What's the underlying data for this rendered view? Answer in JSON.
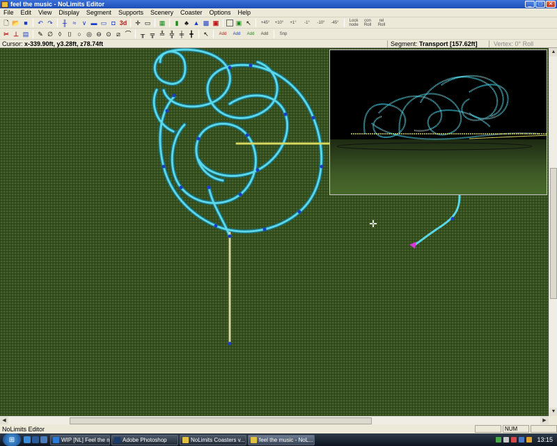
{
  "window": {
    "title": "feel the music - NoLimits Editor",
    "buttons": {
      "minimize": "_",
      "maximize": "□",
      "close": "✕"
    }
  },
  "menu": [
    "File",
    "Edit",
    "View",
    "Display",
    "Segment",
    "Supports",
    "Scenery",
    "Coaster",
    "Options",
    "Help"
  ],
  "toolbar1": {
    "label_3d": "3d",
    "angle_buttons": [
      "+45°",
      "+10°",
      "+1°",
      "-1°",
      "-10°",
      "-45°"
    ],
    "lock_label": "Lock node",
    "con_roll_label": "con Roll",
    "rel_roll_label": "rel Roll"
  },
  "toolbar2": {
    "add_labels": [
      "Add",
      "Add",
      "Add",
      "Add"
    ],
    "snp_label": "Snp"
  },
  "info": {
    "cursor_label": "Cursor:",
    "cursor_value": "x-339.90ft, y3.28ft, z78.74ft",
    "segment_label": "Segment:",
    "segment_value": "Transport [157.62ft]",
    "vertex_label": "Vertex:",
    "vertex_value": "0° Roll"
  },
  "status": {
    "message": "NoLimits Editor",
    "panes": [
      "",
      "NUM",
      ""
    ]
  },
  "taskbar": {
    "tasks": [
      {
        "label": "WIP [NL] Feel the m...",
        "icon_color": "#2a7ad8"
      },
      {
        "label": "Adobe Photoshop",
        "icon_color": "#1b3a6a"
      },
      {
        "label": "NoLimits Coasters v...",
        "icon_color": "#e0c040"
      },
      {
        "label": "feel the music - NoL...",
        "icon_color": "#e0c040"
      }
    ],
    "clock": "13:15"
  },
  "colors": {
    "track": "#5ad8e8",
    "node": "#1a3cc8",
    "transport_track": "#d8d8a0",
    "selected_vertex": "#d838d8",
    "ground": "#37531f"
  }
}
